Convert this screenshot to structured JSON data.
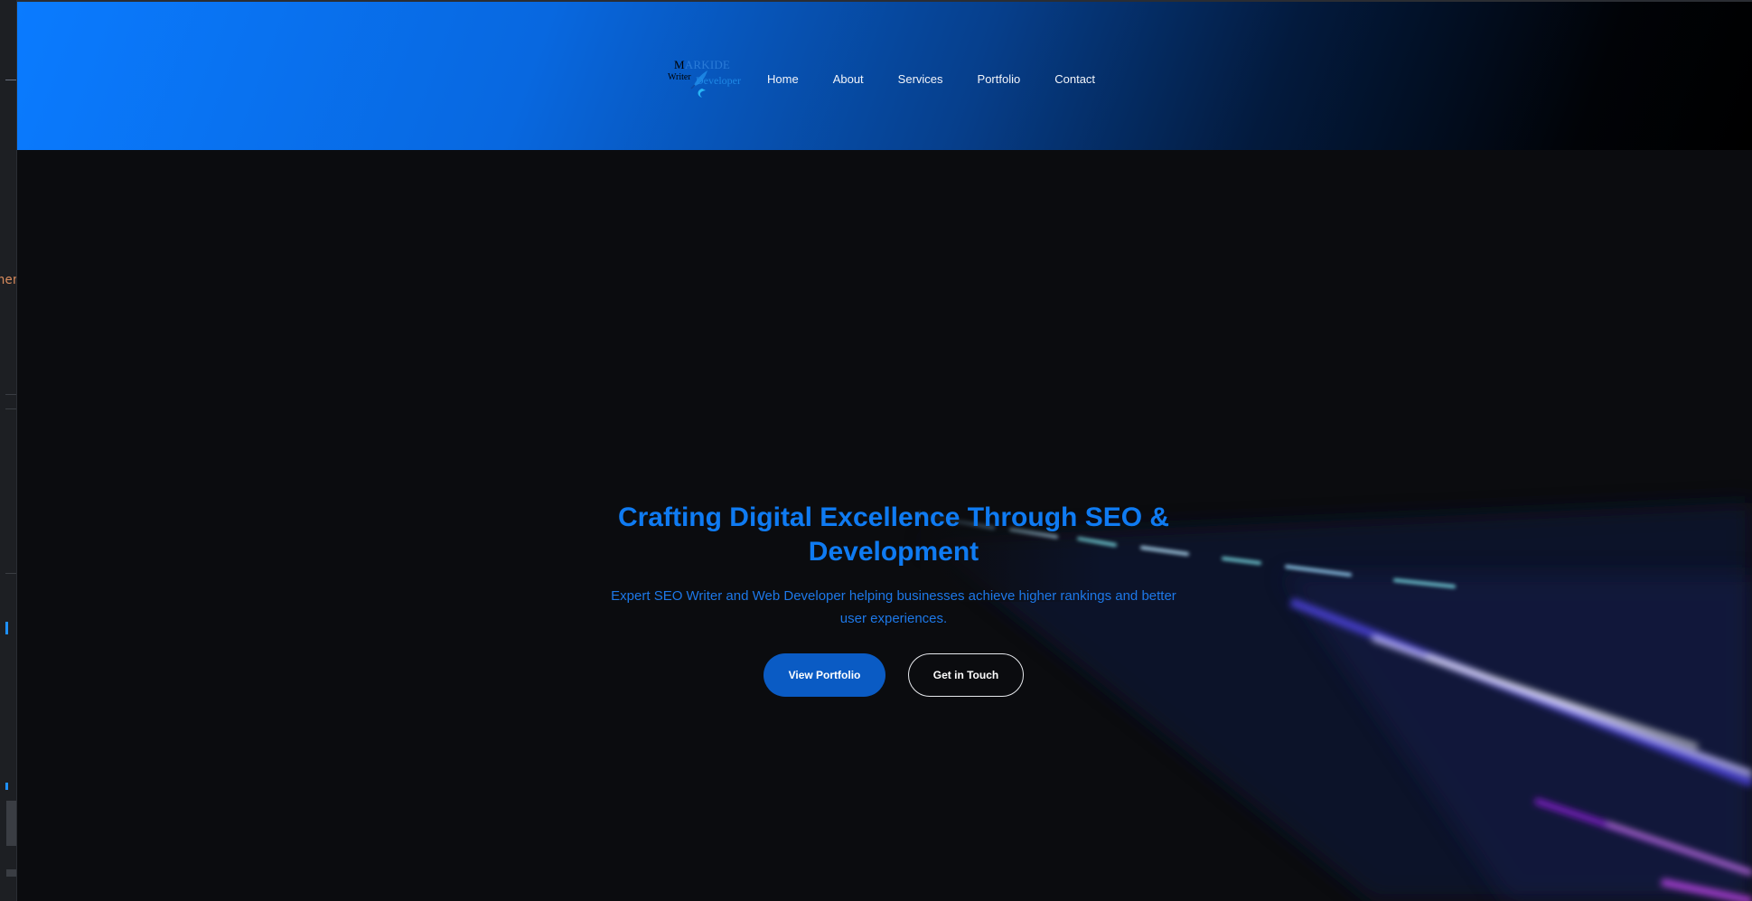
{
  "side_panel": {
    "fragment_text": "hen"
  },
  "header": {
    "logo": {
      "line1_initial": "M",
      "line1_rest": "ARKIDE",
      "line2": "Writer",
      "line3": "Developer"
    },
    "nav": [
      {
        "label": "Home"
      },
      {
        "label": "About"
      },
      {
        "label": "Services"
      },
      {
        "label": "Portfolio"
      },
      {
        "label": "Contact"
      }
    ]
  },
  "hero": {
    "title": "Crafting Digital Excellence Through SEO & Development",
    "subtitle": "Expert SEO Writer and Web Developer helping businesses achieve higher rankings and better user experiences.",
    "primary_button": "View Portfolio",
    "secondary_button": "Get in Touch"
  },
  "colors": {
    "header_gradient_start": "#0a7bff",
    "header_gradient_end": "#000000",
    "page_background": "#0b0c0f",
    "accent_blue": "#0f7bf2",
    "primary_button": "#0a5bc4"
  }
}
